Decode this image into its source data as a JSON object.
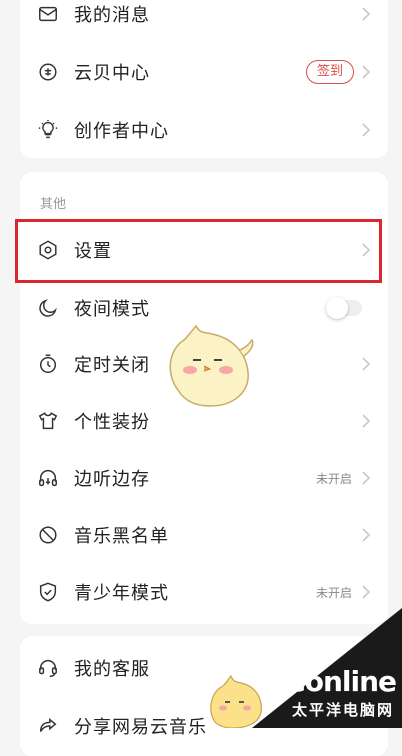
{
  "menu_top": [
    {
      "label": "我的消息",
      "icon": "mail-icon"
    },
    {
      "label": "云贝中心",
      "icon": "coin-icon",
      "badge": "签到"
    },
    {
      "label": "创作者中心",
      "icon": "lightbulb-icon"
    }
  ],
  "other_section": {
    "title": "其他",
    "items": [
      {
        "label": "设置",
        "icon": "settings-icon"
      },
      {
        "label": "夜间模式",
        "icon": "moon-icon",
        "toggle": false
      },
      {
        "label": "定时关闭",
        "icon": "timer-icon"
      },
      {
        "label": "个性装扮",
        "icon": "shirt-icon"
      },
      {
        "label": "边听边存",
        "icon": "headphones-icon",
        "status": "未开启"
      },
      {
        "label": "音乐黑名单",
        "icon": "block-icon"
      },
      {
        "label": "青少年模式",
        "icon": "shield-icon",
        "status": "未开启"
      }
    ]
  },
  "menu_bottom": [
    {
      "label": "我的客服",
      "icon": "headset-icon"
    },
    {
      "label": "分享网易云音乐",
      "icon": "share-icon"
    }
  ],
  "watermark": {
    "logo": "PConline",
    "sub": "太平洋电脑网"
  },
  "colors": {
    "accent": "#d84d4d",
    "highlight": "#d9262f",
    "background": "#f5f5f6"
  }
}
